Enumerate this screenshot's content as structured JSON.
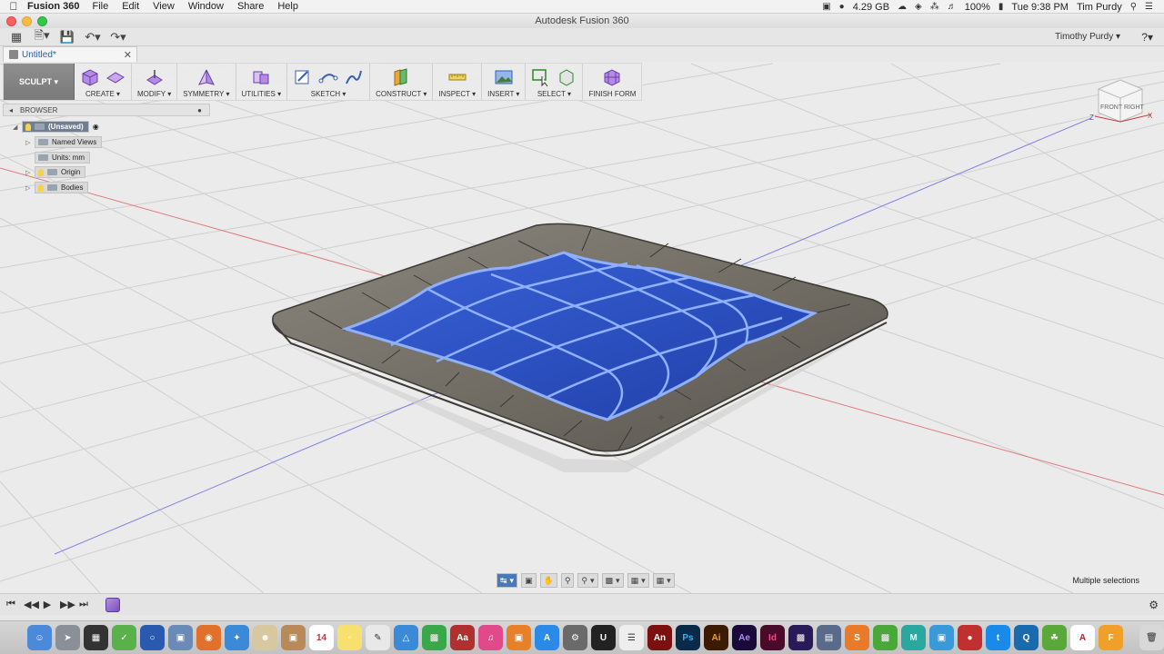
{
  "menubar": {
    "app_name": "Fusion 360",
    "items": [
      "File",
      "Edit",
      "View",
      "Window",
      "Share",
      "Help"
    ],
    "memory": "4.29 GB",
    "battery": "100%",
    "clock": "Tue 9:38 PM",
    "user": "Tim Purdy"
  },
  "window": {
    "title": "Autodesk Fusion 360"
  },
  "app_toolbar": {
    "user_name": "Timothy Purdy ▾",
    "help": "?▾"
  },
  "document_tab": {
    "title": "Untitled*"
  },
  "ribbon": {
    "workspace": "SCULPT ▾",
    "groups": [
      {
        "label": "CREATE ▾"
      },
      {
        "label": "MODIFY ▾"
      },
      {
        "label": "SYMMETRY ▾"
      },
      {
        "label": "UTILITIES ▾"
      },
      {
        "label": "SKETCH ▾"
      },
      {
        "label": "CONSTRUCT ▾"
      },
      {
        "label": "INSPECT ▾"
      },
      {
        "label": "INSERT ▾"
      },
      {
        "label": "SELECT ▾"
      },
      {
        "label": "FINISH FORM"
      }
    ]
  },
  "browser": {
    "title": "BROWSER",
    "root": "(Unsaved)",
    "nodes": [
      "Named Views",
      "Units: mm",
      "Origin",
      "Bodies"
    ]
  },
  "viewcube": {
    "front": "FRONT",
    "right": "RIGHT",
    "axis_z": "Z",
    "axis_x": "X"
  },
  "status": {
    "selection": "Multiple selections"
  },
  "colors": {
    "accent": "#2f56c8",
    "face": "#2a4fc2",
    "edge": "#8fb0ff",
    "body": "#6d6a64",
    "grid_red": "#e07a7a",
    "grid_blue": "#8080e8"
  }
}
